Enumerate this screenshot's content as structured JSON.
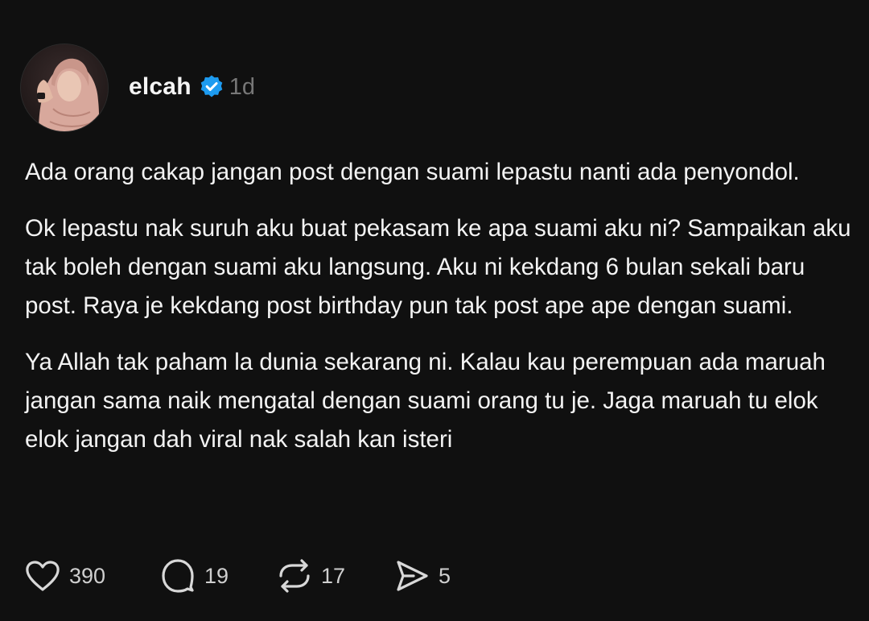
{
  "post": {
    "author": {
      "username": "elcah",
      "verified": true,
      "avatar_icon": "profile-photo"
    },
    "timestamp": "1d",
    "paragraphs": [
      "Ada orang cakap jangan post dengan suami lepastu nanti ada penyondol.",
      "Ok lepastu nak suruh aku buat pekasam ke apa suami aku ni? Sampaikan aku tak boleh dengan suami aku langsung. Aku ni kekdang 6 bulan sekali baru post. Raya je kekdang post birthday pun tak post ape ape dengan suami.",
      "Ya Allah tak paham la dunia sekarang ni. Kalau kau perempuan ada maruah jangan sama naik mengatal dengan suami orang tu je. Jaga maruah tu elok elok jangan dah viral nak salah kan isteri"
    ],
    "actions": {
      "likes": "390",
      "replies": "19",
      "reposts": "17",
      "shares": "5"
    }
  },
  "colors": {
    "background": "#101010",
    "text": "#f3f3f3",
    "muted": "#777777",
    "verified": "#1d9bf0"
  }
}
